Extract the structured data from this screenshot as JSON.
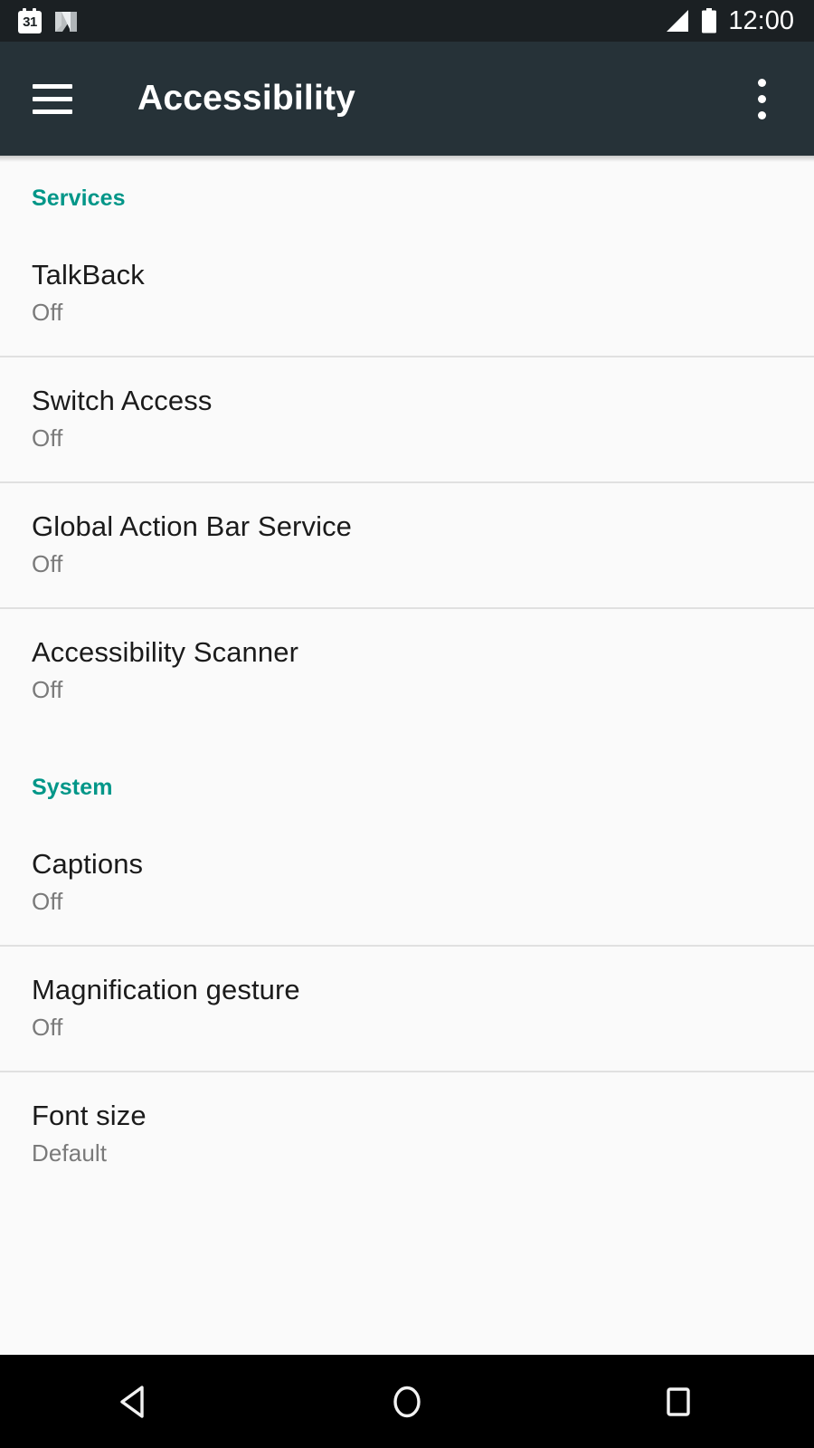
{
  "status_bar": {
    "calendar_day": "31",
    "icons": [
      "calendar-icon",
      "android-n-logo-icon",
      "signal-icon",
      "battery-icon"
    ],
    "time": "12:00",
    "background_color": "#1b2023",
    "foreground_color": "#ffffff"
  },
  "app_bar": {
    "menu_icon": "hamburger-menu-icon",
    "title": "Accessibility",
    "overflow_icon": "overflow-menu-icon",
    "background_color": "#263238",
    "title_color": "#ffffff"
  },
  "theme": {
    "accent_color": "#009688",
    "page_background": "#fafafa",
    "divider_color": "#e0e0e0",
    "primary_text_color": "#1b1b1b",
    "secondary_text_color": "#7a7a7a"
  },
  "sections": [
    {
      "header": "Services",
      "items": [
        {
          "title": "TalkBack",
          "summary": "Off"
        },
        {
          "title": "Switch Access",
          "summary": "Off"
        },
        {
          "title": "Global Action Bar Service",
          "summary": "Off"
        },
        {
          "title": "Accessibility Scanner",
          "summary": "Off"
        }
      ]
    },
    {
      "header": "System",
      "items": [
        {
          "title": "Captions",
          "summary": "Off"
        },
        {
          "title": "Magnification gesture",
          "summary": "Off"
        },
        {
          "title": "Font size",
          "summary": "Default"
        }
      ]
    }
  ],
  "nav_bar": {
    "background_color": "#000000",
    "buttons": [
      {
        "name": "back-button",
        "icon": "back-triangle-icon"
      },
      {
        "name": "home-button",
        "icon": "home-circle-icon"
      },
      {
        "name": "recents-button",
        "icon": "recents-square-icon"
      }
    ]
  }
}
